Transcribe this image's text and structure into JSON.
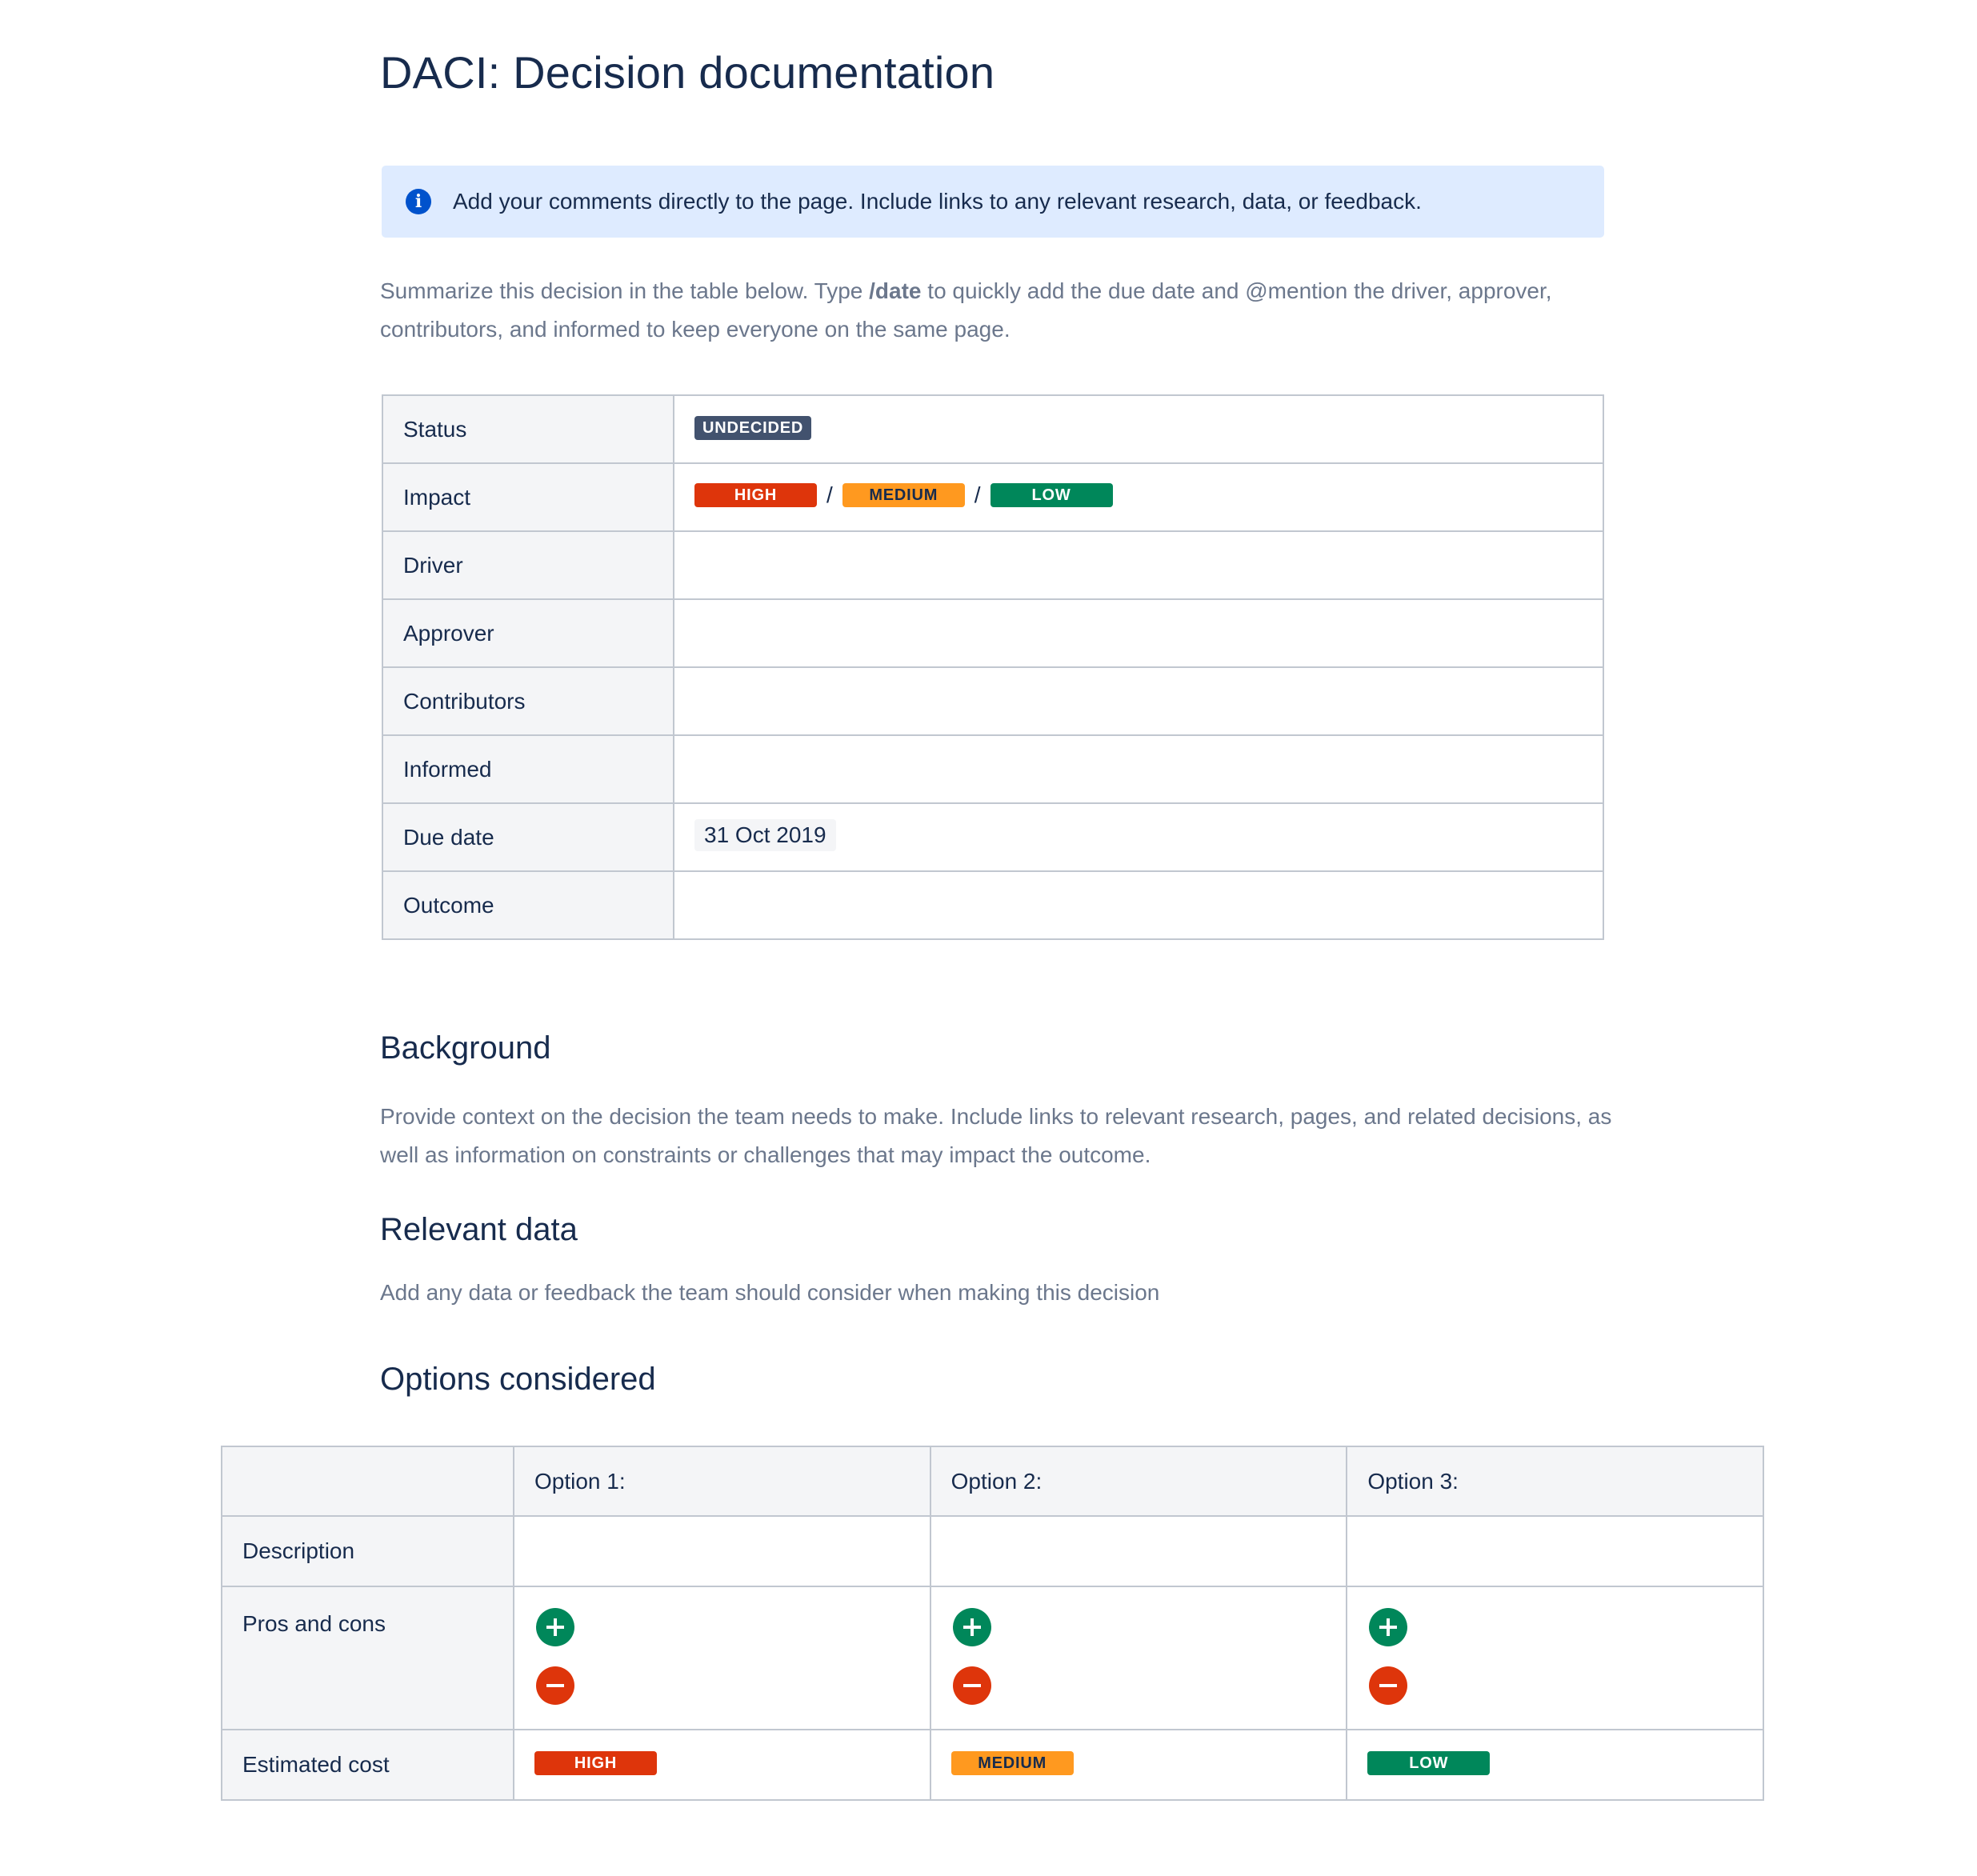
{
  "page": {
    "title": "DACI: Decision documentation",
    "info_panel": {
      "icon": "info-icon",
      "text": "Add your comments directly to the page. Include links to any relevant research, data, or feedback."
    },
    "intro": {
      "part1": "Summarize this decision in the table below. Type ",
      "command": "/date",
      "part2": " to quickly add the due date and @mention the driver, approver, contributors, and informed to keep everyone on the same page."
    }
  },
  "summary_table": {
    "status_label": "Status",
    "status_value": "UNDECIDED",
    "impact_label": "Impact",
    "impact_high": "HIGH",
    "impact_medium": "MEDIUM",
    "impact_low": "LOW",
    "separator": "/",
    "driver_label": "Driver",
    "approver_label": "Approver",
    "contributors_label": "Contributors",
    "informed_label": "Informed",
    "due_date_label": "Due date",
    "due_date_value": "31 Oct 2019",
    "outcome_label": "Outcome"
  },
  "background": {
    "heading": "Background",
    "text": "Provide context on the decision the team needs to make. Include links to relevant research, pages, and related decisions, as well as information on constraints or challenges that may impact the outcome."
  },
  "relevant_data": {
    "heading": "Relevant data",
    "text": "Add any data or feedback the team should consider when making this decision"
  },
  "options": {
    "heading": "Options considered",
    "columns": [
      "Option 1:",
      "Option 2:",
      "Option 3:"
    ],
    "rows": {
      "description": "Description",
      "pros_cons": "Pros and cons",
      "estimated_cost": "Estimated cost"
    },
    "costs": [
      "HIGH",
      "MEDIUM",
      "LOW"
    ],
    "icons": {
      "pro": "plus-circle-icon",
      "con": "minus-circle-icon"
    },
    "colors": {
      "high": "#de350b",
      "medium": "#ff991f",
      "low": "#00875a",
      "undecided": "#42526e",
      "info": "#0052cc"
    }
  }
}
